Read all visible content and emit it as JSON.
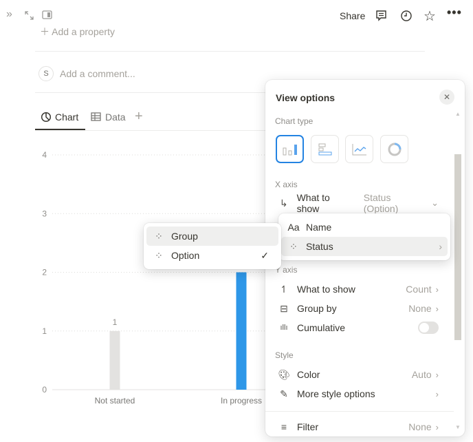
{
  "topbar": {
    "share_label": "Share",
    "icons": [
      "sidebar-expand-icon",
      "fullscreen-icon",
      "side-peek-icon",
      "comment-icon",
      "history-icon",
      "star-icon",
      "more-icon"
    ]
  },
  "page": {
    "add_property": "Add a property",
    "avatar_initial": "S",
    "comment_placeholder": "Add a comment..."
  },
  "tabs": [
    {
      "label": "Chart",
      "icon": "chart-icon",
      "active": true
    },
    {
      "label": "Data",
      "icon": "table-icon"
    }
  ],
  "chart_data": {
    "type": "bar",
    "categories": [
      "Not started",
      "In progress"
    ],
    "values": [
      1,
      2
    ],
    "data_labels": [
      "1",
      ""
    ],
    "yticks": [
      "0",
      "1",
      "2",
      "3",
      "4"
    ],
    "ylim": [
      0,
      4
    ],
    "grid": true,
    "colors": [
      "#e3e2e0",
      "#2e97e8"
    ]
  },
  "view_options": {
    "title": "View options",
    "chart_type_label": "Chart type",
    "chart_types": [
      "vertical-bar",
      "horizontal-bar",
      "line",
      "donut"
    ],
    "selected_chart_type": "vertical-bar",
    "x_axis_label": "X axis",
    "x_what_to_show": {
      "label": "What to show",
      "value": "Status (Option)"
    },
    "y_axis_label": "Y axis",
    "y_what_to_show": {
      "label": "What to show",
      "value": "Count"
    },
    "group_by": {
      "label": "Group by",
      "value": "None"
    },
    "cumulative": {
      "label": "Cumulative",
      "on": false
    },
    "style_label": "Style",
    "color": {
      "label": "Color",
      "value": "Auto"
    },
    "more_style": {
      "label": "More style options"
    },
    "filter": {
      "label": "Filter",
      "value": "None"
    }
  },
  "property_menu": {
    "items": [
      {
        "label": "Name",
        "icon": "text-icon",
        "icon_text": "Aa"
      },
      {
        "label": "Status",
        "icon": "status-icon"
      }
    ]
  },
  "status_submenu": {
    "items": [
      {
        "label": "Group",
        "checked": false
      },
      {
        "label": "Option",
        "checked": true
      }
    ],
    "check": "✓"
  }
}
